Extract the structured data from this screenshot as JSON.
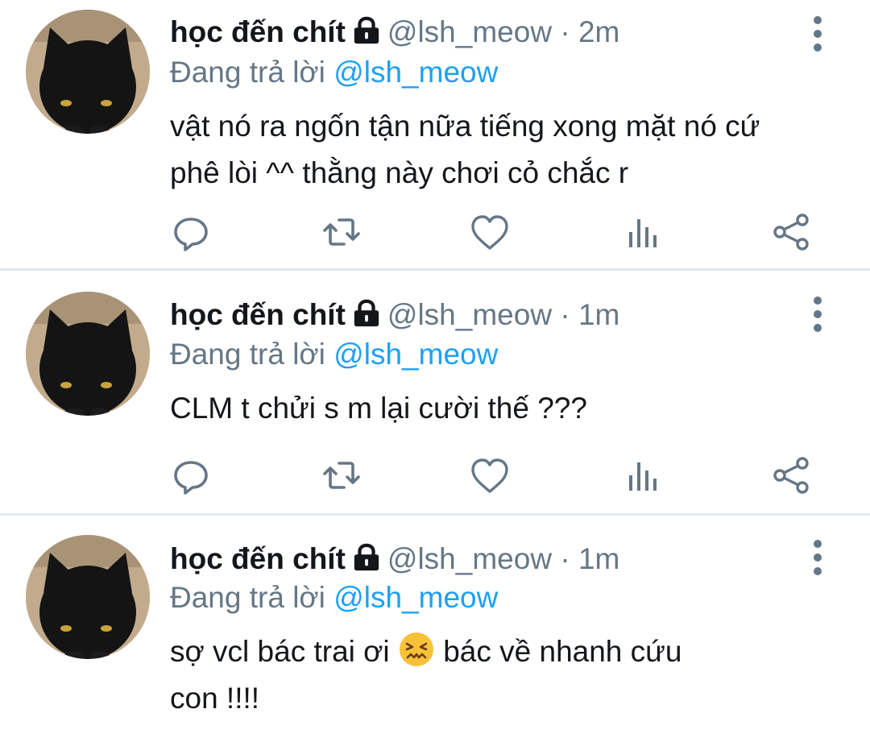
{
  "tweets": [
    {
      "display_name": "học đến chít",
      "handle": "@lsh_meow",
      "separator": "·",
      "time": "2m",
      "reply_prefix": "Đang trả lời",
      "reply_to": "@lsh_meow",
      "body_line1": "vật nó ra ngốn tận nữa tiếng xong mặt nó cứ",
      "body_line2": "phê lòi ^^ thằng này chơi cỏ chắc r"
    },
    {
      "display_name": "học đến chít",
      "handle": "@lsh_meow",
      "separator": "·",
      "time": "1m",
      "reply_prefix": "Đang trả lời",
      "reply_to": "@lsh_meow",
      "body_line1": "CLM t chửi s m lại cười thế ???"
    },
    {
      "display_name": "học đến chít",
      "handle": "@lsh_meow",
      "separator": "·",
      "time": "1m",
      "reply_prefix": "Đang trả lời",
      "reply_to": "@lsh_meow",
      "body_part1": "sợ vcl bác trai ơi",
      "body_emoji": "confounded-face-emoji",
      "body_part2": "bác về nhanh cứu",
      "body_line2": "con !!!!"
    }
  ],
  "icons": {
    "reply": "reply-icon",
    "retweet": "retweet-icon",
    "like": "heart-icon",
    "analytics": "analytics-icon",
    "share": "share-icon",
    "more": "more-vertical-icon",
    "lock": "lock-icon"
  },
  "colors": {
    "text": "#14171a",
    "muted": "#657786",
    "mention": "#1da1f2",
    "divider": "#e1e8ed"
  }
}
